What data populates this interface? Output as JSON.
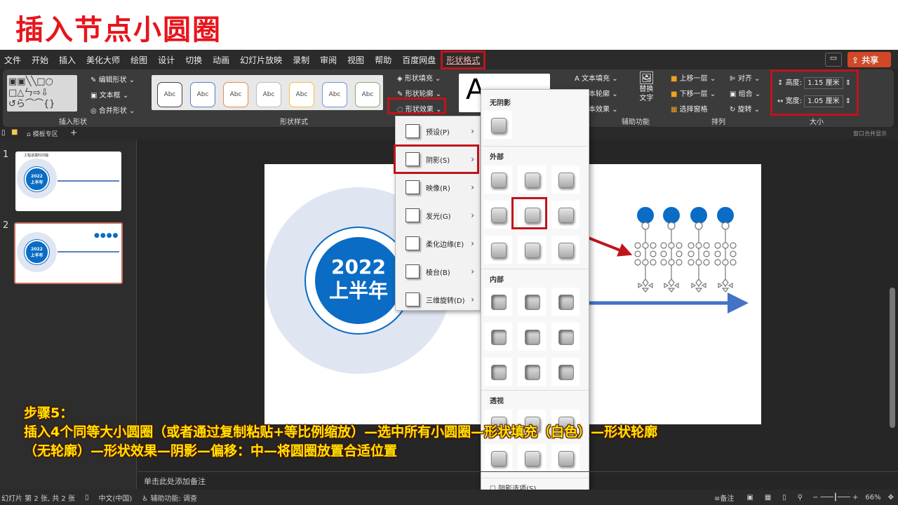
{
  "banner": {
    "title": "插入节点小圆圈"
  },
  "menu": [
    "文件",
    "开始",
    "插入",
    "美化大师",
    "绘图",
    "设计",
    "切换",
    "动画",
    "幻灯片放映",
    "录制",
    "审阅",
    "视图",
    "帮助",
    "百度网盘"
  ],
  "menu_active": "形状格式",
  "share": "共享",
  "ribbon": {
    "edit_shape": "编辑形状",
    "text_box": "文本框",
    "merge_shapes": "合并形状",
    "insert_shapes_label": "插入形状",
    "style_sample": "Abc",
    "shape_styles_label": "形状样式",
    "shape_fill": "形状填充",
    "shape_outline": "形状轮廓",
    "shape_effects": "形状效果",
    "text_fill": "文本填充",
    "text_outline": "文本轮廓",
    "text_effects": "文本效果",
    "alt_text_1": "替换",
    "alt_text_2": "文字",
    "accessibility_label": "辅助功能",
    "bring_forward": "上移一层",
    "send_backward": "下移一层",
    "selection_pane": "选择窗格",
    "align": "对齐",
    "group": "组合",
    "rotate": "旋转",
    "arrange_label": "排列",
    "height_label": "高度:",
    "height_value": "1.15 厘米",
    "width_label": "宽度:",
    "width_value": "1.05 厘米",
    "size_label": "大小"
  },
  "tabs": {
    "template_zone": "模板专区",
    "merge_windows": "窗口合并显示"
  },
  "slides": [
    {
      "num": "1",
      "title": "工程进展时间轴",
      "year": "2022",
      "half": "上半年"
    },
    {
      "num": "2",
      "year": "2022",
      "half": "上半年"
    }
  ],
  "slide": {
    "year": "2022",
    "half": "上半年"
  },
  "effects_menu": [
    {
      "label": "预设(P)"
    },
    {
      "label": "阴影(S)"
    },
    {
      "label": "映像(R)"
    },
    {
      "label": "发光(G)"
    },
    {
      "label": "柔化边缘(E)"
    },
    {
      "label": "棱台(B)"
    },
    {
      "label": "三维旋转(D)"
    }
  ],
  "shadow_gallery": {
    "no_shadow": "无阴影",
    "outer": "外部",
    "inner": "内部",
    "perspective": "透视",
    "options": "阴影选项(S)..."
  },
  "notes": "单击此处添加备注",
  "status": {
    "slide_info": "幻灯片 第 2 张, 共 2 张",
    "language": "中文(中国)",
    "accessibility": "辅助功能: 调查",
    "notes": "备注",
    "zoom": "66%"
  },
  "caption": {
    "line1": "步骤5：",
    "line2": "插入4个同等大小圆圈（或者通过复制粘贴+等比例缩放）—选中所有小圆圈—形状填充（白色）—形状轮廓",
    "line3": "（无轮廓）—形状效果—阴影—偏移：中—将圆圈放置合适位置"
  },
  "colors": {
    "accent_red": "#c0141b",
    "title_red": "#e8141b",
    "slide_blue": "#0a6cc4",
    "caption_yellow": "#ffe400",
    "share_orange": "#d24726"
  }
}
